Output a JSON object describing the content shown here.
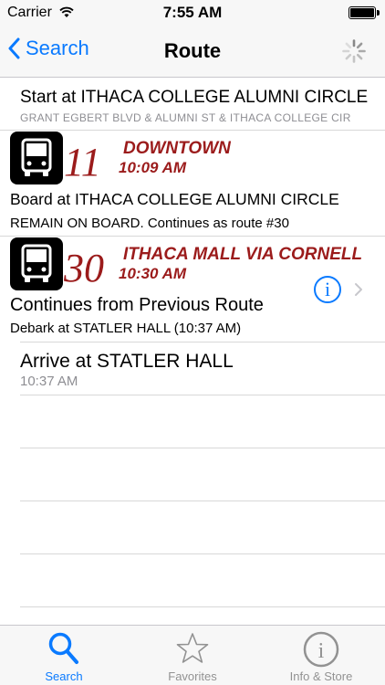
{
  "status": {
    "carrier": "Carrier",
    "time": "7:55 AM"
  },
  "nav": {
    "back_label": "Search",
    "title": "Route"
  },
  "start": {
    "title": "Start at ITHACA COLLEGE ALUMNI CIRCLE",
    "subtitle": "GRANT EGBERT BLVD & ALUMNI ST & ITHACA COLLEGE CIR"
  },
  "routes": [
    {
      "number": "11",
      "name": "DOWNTOWN",
      "time": "10:09 AM",
      "line1": "Board at ITHACA COLLEGE ALUMNI CIRCLE",
      "line2": "REMAIN ON BOARD. Continues as route #30"
    },
    {
      "number": "30",
      "name": "ITHACA MALL VIA CORNELL",
      "time": "10:30 AM",
      "line1": "Continues from Previous Route",
      "line2": "Debark at STATLER HALL (10:37 AM)"
    }
  ],
  "arrive": {
    "title": "Arrive at STATLER HALL",
    "time": "10:37 AM"
  },
  "tabs": [
    {
      "label": "Search",
      "icon": "search-icon",
      "active": true
    },
    {
      "label": "Favorites",
      "icon": "star-icon",
      "active": false
    },
    {
      "label": "Info & Store",
      "icon": "info-icon",
      "active": false
    }
  ],
  "colors": {
    "accent": "#0a7aff",
    "route": "#9b1b1b",
    "secondary_text": "#8e8e93"
  }
}
